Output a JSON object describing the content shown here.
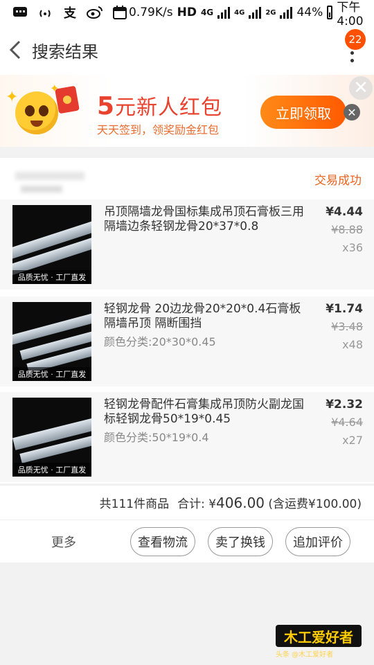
{
  "statusbar": {
    "speed": "0.79K/s",
    "hd": "HD",
    "net1": "4G",
    "net2": "4G",
    "net3": "2G",
    "battery": "44%",
    "time": "下午4:00",
    "icons": [
      "message-icon",
      "wifi-hotspot-icon",
      "alipay-icon",
      "weibo-icon",
      "calendar-icon"
    ]
  },
  "nav": {
    "title": "搜索结果",
    "badge": "22"
  },
  "banner": {
    "amount": "5",
    "title_rest": "元新人红包",
    "subtitle": "天天签到，领奖励金红包",
    "button": "立即领取",
    "colors": {
      "accent": "#ff5a00",
      "title": "#e8432f"
    }
  },
  "order": {
    "status": "交易成功",
    "items": [
      {
        "title": "吊顶隔墙龙骨国标集成吊顶石膏板三用隔墙边条轻钢龙骨20*37*0.8",
        "sku": "",
        "price": "¥4.44",
        "old_price": "¥8.88",
        "qty": "x36",
        "thumb_caption": "品质无忧 · 工厂直发"
      },
      {
        "title": "轻钢龙骨 20边龙骨20*20*0.4石膏板隔墙吊顶 隔断围挡",
        "sku": "颜色分类:20*30*0.45",
        "price": "¥1.74",
        "old_price": "¥3.48",
        "qty": "x48",
        "thumb_caption": "品质无忧 · 工厂直发"
      },
      {
        "title": "轻钢龙骨配件石膏集成吊顶防火副龙国标轻钢龙骨50*19*0.45",
        "sku": "颜色分类:50*19*0.4",
        "price": "¥2.32",
        "old_price": "¥4.64",
        "qty": "x27",
        "thumb_caption": "品质无忧 · 工厂直发"
      }
    ]
  },
  "summary": {
    "count": "共111件商品",
    "total_label": "合计: ¥",
    "total_amount": "406.00",
    "shipping": "(含运费¥100.00)"
  },
  "actions": {
    "more": "更多",
    "logistics": "查看物流",
    "resell": "卖了换钱",
    "review": "追加评价"
  },
  "watermark": {
    "logo": "木工爱好者",
    "sub": "头条 @木工爱好者"
  }
}
